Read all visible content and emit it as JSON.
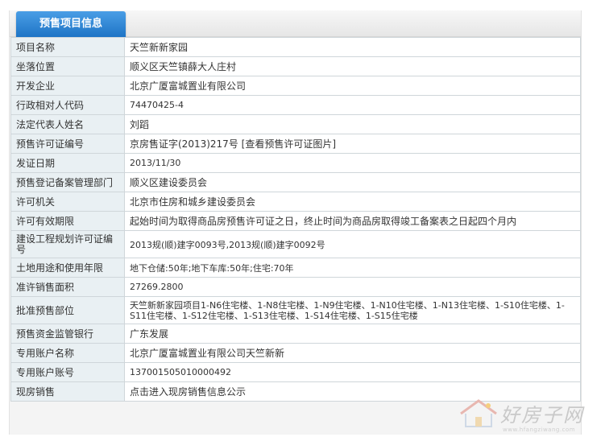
{
  "header": {
    "tab_title": "预售项目信息"
  },
  "rows": [
    {
      "label": "项目名称",
      "value": "天竺新新家园"
    },
    {
      "label": "坐落位置",
      "value": "顺义区天竺镇薛大人庄村"
    },
    {
      "label": "开发企业",
      "value": "北京广厦富城置业有限公司"
    },
    {
      "label": "行政相对人代码",
      "value": "74470425-4"
    },
    {
      "label": "法定代表人姓名",
      "value": "刘蹈"
    },
    {
      "label": "预售许可证编号",
      "value": "京房售证字(2013)217号",
      "link": "[查看预售许可证图片]"
    },
    {
      "label": "发证日期",
      "value": "2013/11/30"
    },
    {
      "label": "预售登记备案管理部门",
      "value": "顺义区建设委员会"
    },
    {
      "label": "许可机关",
      "value": "北京市住房和城乡建设委员会"
    },
    {
      "label": "许可有效期限",
      "value": "起始时间为取得商品房预售许可证之日，终止时间为商品房取得竣工备案表之日起四个月内"
    },
    {
      "label": "建设工程规划许可证编号",
      "value": "2013规(顺)建字0093号,2013规(顺)建字0092号"
    },
    {
      "label": "土地用途和使用年限",
      "value": "地下仓储:50年;地下车库:50年;住宅:70年"
    },
    {
      "label": "准许销售面积",
      "value": "27269.2800"
    },
    {
      "label": "批准预售部位",
      "value": "天竺新新家园项目1-N6住宅楼、1-N8住宅楼、1-N9住宅楼、1-N10住宅楼、1-N13住宅楼、1-S10住宅楼、1-S11住宅楼、1-S12住宅楼、1-S13住宅楼、1-S14住宅楼、1-S15住宅楼"
    },
    {
      "label": "预售资金监管银行",
      "value": "广东发展"
    },
    {
      "label": "专用账户名称",
      "value": "北京广厦富城置业有限公司天竺新新"
    },
    {
      "label": "专用账户账号",
      "value": "137001505010000492"
    },
    {
      "label": "现房销售",
      "value": "点击进入现房销售信息公示"
    }
  ],
  "watermark": {
    "text": "好房子网",
    "url": "www.hfangziwang.com"
  },
  "colors": {
    "tab_blue": "#2a86d8",
    "label_bg": "#e9f0f3",
    "border": "#cfd6da"
  },
  "icons": [
    "house-logo-icon"
  ]
}
